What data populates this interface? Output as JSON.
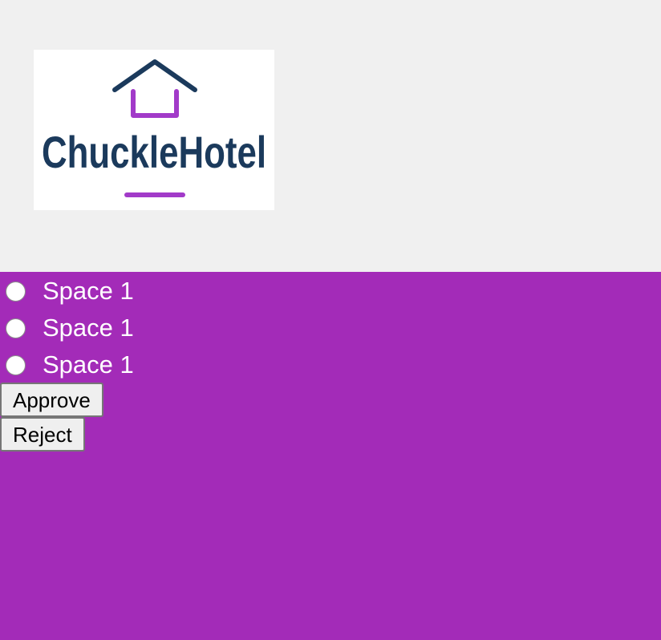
{
  "brand": {
    "logo_text": "ChuckleHotel",
    "colors": {
      "navy": "#1b3a5c",
      "accent": "#a23ac9"
    }
  },
  "theme": {
    "header_bg": "#f0f0f0",
    "main_bg": "#a32bb8"
  },
  "options": [
    {
      "label": "Space 1",
      "selected": false
    },
    {
      "label": "Space 1",
      "selected": false
    },
    {
      "label": "Space 1",
      "selected": false
    }
  ],
  "actions": {
    "approve_label": "Approve",
    "reject_label": "Reject"
  }
}
